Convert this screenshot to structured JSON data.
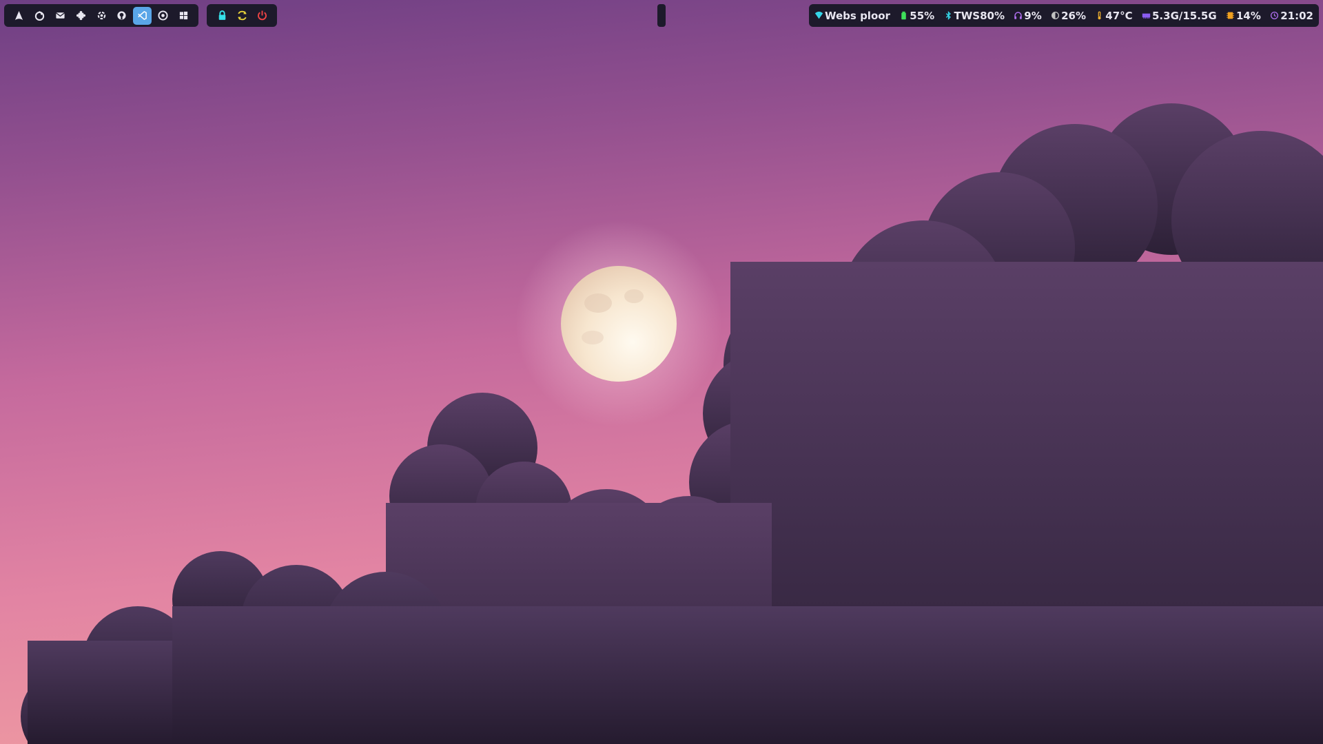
{
  "topbar": {
    "launcher_apps": [
      {
        "icon": "arch-linux-icon"
      },
      {
        "icon": "firefox-icon"
      },
      {
        "icon": "mail-icon"
      },
      {
        "icon": "puzzle-icon"
      },
      {
        "icon": "settings-icon"
      },
      {
        "icon": "github-icon"
      },
      {
        "icon": "vscode-icon",
        "active": true
      },
      {
        "icon": "chrome-icon"
      },
      {
        "icon": "windows-icon"
      }
    ],
    "power_actions": [
      {
        "icon": "lock-icon",
        "color": "#36e0e8"
      },
      {
        "icon": "refresh-icon",
        "color": "#e8d23a"
      },
      {
        "icon": "power-icon",
        "color": "#ef4444"
      }
    ],
    "status": {
      "wifi": {
        "icon": "wifi-icon",
        "label": "Webs ploor",
        "color": "#35d6e8"
      },
      "battery": {
        "icon": "battery-icon",
        "label": "55%",
        "color": "#3ee05a"
      },
      "bluetooth": {
        "icon": "bluetooth-icon",
        "label": "TWS80%",
        "color": "#35d6e8"
      },
      "volume": {
        "icon": "headphones-icon",
        "label": "9%",
        "color": "#b06ff0"
      },
      "brightness": {
        "icon": "brightness-icon",
        "label": "26%",
        "color": "#c0c0c0"
      },
      "temperature": {
        "icon": "thermometer-icon",
        "label": "47°C",
        "color": "#f0b030"
      },
      "memory": {
        "icon": "memory-icon",
        "label": "5.3G/15.5G",
        "color": "#8a5cf0"
      },
      "cpu": {
        "icon": "cpu-icon",
        "label": "14%",
        "color": "#f0a020"
      },
      "clock": {
        "icon": "clock-icon",
        "label": "21:02",
        "color": "#b06ff0"
      }
    }
  }
}
